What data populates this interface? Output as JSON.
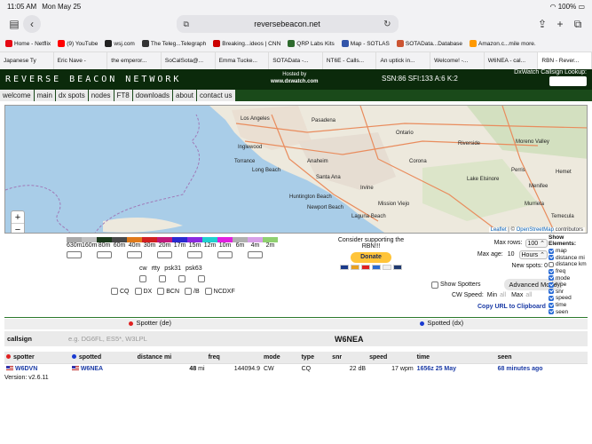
{
  "status": {
    "time": "11:05 AM",
    "date": "Mon May 25",
    "battery": "100%"
  },
  "browser": {
    "url": "reversebeacon.net"
  },
  "bookmarks": [
    {
      "label": "Home - Netflix",
      "color": "#e50914"
    },
    {
      "label": "(9) YouTube",
      "color": "#ff0000"
    },
    {
      "label": "wsj.com",
      "color": "#222222"
    },
    {
      "label": "The Teleg...Telegraph",
      "color": "#333333"
    },
    {
      "label": "Breaking...ideos | CNN",
      "color": "#cc0000"
    },
    {
      "label": "QRP Labs Kits",
      "color": "#2d6a2d"
    },
    {
      "label": "Map - SOTLAS",
      "color": "#3355aa"
    },
    {
      "label": "SOTAData...Database",
      "color": "#cc5533"
    },
    {
      "label": "Amazon.c...mile more.",
      "color": "#ff9900"
    }
  ],
  "tabs": [
    {
      "label": "Japanese Ty"
    },
    {
      "label": "Eric Nave -"
    },
    {
      "label": "the emperor..."
    },
    {
      "label": "SoCalSota@..."
    },
    {
      "label": "Emma Tucke..."
    },
    {
      "label": "SOTAData -..."
    },
    {
      "label": "NT6E - Calls..."
    },
    {
      "label": "An uptick in..."
    },
    {
      "label": "Welcome! -..."
    },
    {
      "label": "W6NEA - cal..."
    },
    {
      "label": "RBN - Rever..."
    }
  ],
  "rbn": {
    "title": "REVERSE BEACON NETWORK",
    "hosted_by": "Hosted by",
    "hosted_site": "www.dxwatch.com",
    "solar": "SSN:86 SFI:133 A:6 K:2",
    "lookup_label": "DxWatch Callsign Lookup:"
  },
  "nav": [
    "welcome",
    "main",
    "dx spots",
    "nodes",
    "FT8",
    "downloads",
    "about",
    "contact us"
  ],
  "map": {
    "zoom_in": "+",
    "zoom_out": "−",
    "attribution_leaflet": "Leaflet",
    "attribution_sep": " | © ",
    "attribution_osm": "OpenStreetMap",
    "attribution_tail": " contributors",
    "cities": [
      {
        "name": "Los Angeles"
      },
      {
        "name": "Pasadena"
      },
      {
        "name": "Ontario"
      },
      {
        "name": "Riverside"
      },
      {
        "name": "Moreno Valley"
      },
      {
        "name": "Inglewood"
      },
      {
        "name": "Corona"
      },
      {
        "name": "Long Beach"
      },
      {
        "name": "Santa Ana"
      },
      {
        "name": "Huntington Beach"
      },
      {
        "name": "Irvine"
      },
      {
        "name": "Menifee"
      },
      {
        "name": "Murrieta"
      },
      {
        "name": "Temecula"
      },
      {
        "name": "Newport Beach"
      },
      {
        "name": "Laguna Beach"
      },
      {
        "name": "Mission Viejo"
      },
      {
        "name": "Anaheim"
      },
      {
        "name": "Torrance"
      },
      {
        "name": "Perris"
      },
      {
        "name": "Hemet"
      },
      {
        "name": "Lake Elsinore"
      }
    ]
  },
  "bands": [
    {
      "label": "630m",
      "color": "#a9a9a9"
    },
    {
      "label": "160m",
      "color": "#c0c0c0"
    },
    {
      "label": "80m",
      "color": "#1a3a1a"
    },
    {
      "label": "60m",
      "color": "#4a4a4a"
    },
    {
      "label": "40m",
      "color": "#e07a1a"
    },
    {
      "label": "30m",
      "color": "#d12020"
    },
    {
      "label": "20m",
      "color": "#c0187a"
    },
    {
      "label": "17m",
      "color": "#2a2ad0"
    },
    {
      "label": "15m",
      "color": "#8a2ae0"
    },
    {
      "label": "12m",
      "color": "#20d0d0"
    },
    {
      "label": "10m",
      "color": "#e020e0"
    },
    {
      "label": "6m",
      "color": "#b0b0b0"
    },
    {
      "label": "4m",
      "color": "#d8a0e8"
    },
    {
      "label": "2m",
      "color": "#90d070"
    }
  ],
  "modes": [
    "cw",
    "rtty",
    "psk31",
    "psk63"
  ],
  "types": [
    "CQ",
    "DX",
    "BCN",
    "/B",
    "NCDXF"
  ],
  "donate": {
    "text": "Consider supporting the RBN!!!",
    "button": "Donate"
  },
  "settings": {
    "max_rows_label": "Max rows:",
    "max_rows": "100",
    "max_age_label": "Max age:",
    "max_age": "10",
    "max_age_unit": "Hours",
    "new_spots": "New spots: 0",
    "show_spotters": "Show Spotters",
    "advanced_mode": "Advanced Mode",
    "cw_speed": "CW Speed:",
    "min": "Min",
    "all": "all",
    "max": "Max",
    "copy_url": "Copy URL to Clipboard"
  },
  "show_elements": {
    "title": "Show Elements:",
    "items": [
      "map",
      "distance mi",
      "distance km",
      "freq",
      "mode",
      "type",
      "snr",
      "speed",
      "time",
      "seen"
    ],
    "checked": [
      true,
      true,
      false,
      true,
      true,
      true,
      true,
      true,
      true,
      true
    ]
  },
  "spotter_de": "Spotter (de)",
  "spotted_dx": "Spotted (dx)",
  "callsign_label": "callsign",
  "callsign_placeholder": "e.g. DG6FL, ES5*, W3LPL",
  "callsign_value": "W6NEA",
  "table": {
    "headers": [
      "spotter",
      "spotted",
      "distance mi",
      "freq",
      "mode",
      "type",
      "snr",
      "speed",
      "time",
      "seen"
    ],
    "rows": [
      {
        "spotter": "W6DVN",
        "spotted": "W6NEA",
        "distance": "48",
        "unit": "mi",
        "freq": "144094.9",
        "mode": "CW",
        "type": "CQ",
        "snr": "22 dB",
        "speed": "17 wpm",
        "time": "1656z 25 May",
        "seen": "68 minutes ago"
      }
    ]
  },
  "version": "Version: v2.6.11",
  "colors": {
    "spotter_dot": "#e02020",
    "spotted_dot": "#1a3ad0",
    "header_bg": "#0b2a0b"
  }
}
